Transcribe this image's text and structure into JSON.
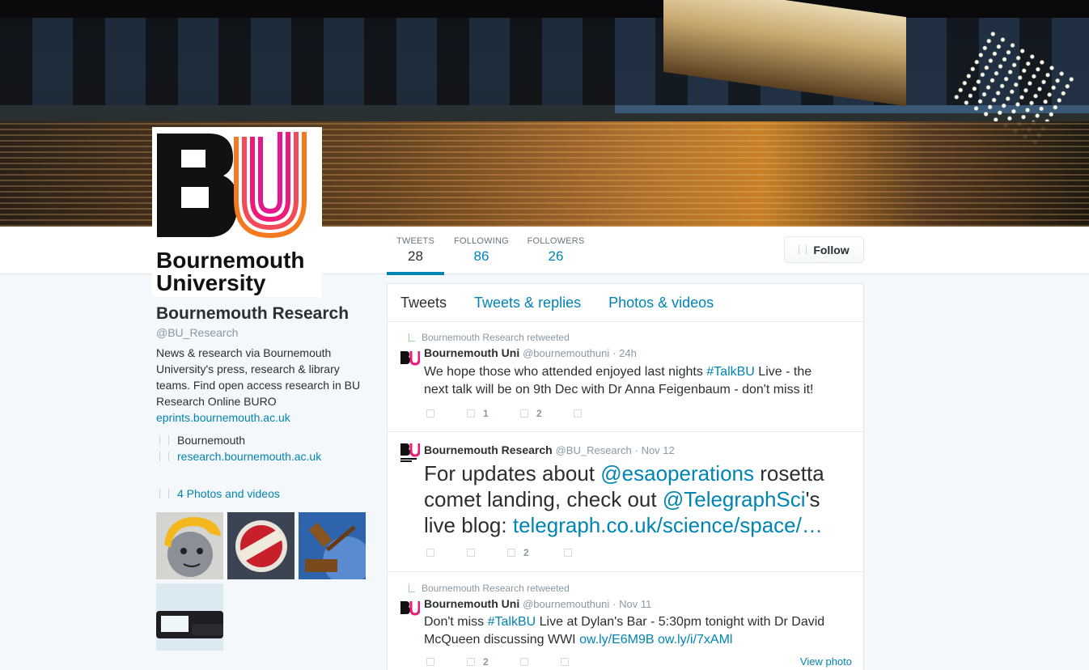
{
  "profile_nav": {
    "stats": [
      {
        "label": "TWEETS",
        "value": "28"
      },
      {
        "label": "FOLLOWING",
        "value": "86"
      },
      {
        "label": "FOLLOWERS",
        "value": "26"
      }
    ],
    "follow_label": "Follow"
  },
  "avatar": {
    "logo_letters": "BU",
    "logo_line1": "Bournemouth",
    "logo_line2": "University"
  },
  "profile": {
    "name": "Bournemouth Research",
    "handle": "@BU_Research",
    "bio": "News & research via Bournemouth University's press, research & library teams. Find open access research in BU Research Online BURO",
    "bio_url": "eprints.bournemouth.ac.uk",
    "location": "Bournemouth",
    "website": "research.bournemouth.ac.uk",
    "photos_label": "4 Photos and videos"
  },
  "tabs": [
    {
      "label": "Tweets",
      "active": true
    },
    {
      "label": "Tweets & replies",
      "active": false
    },
    {
      "label": "Photos & videos",
      "active": false
    }
  ],
  "tweets": [
    {
      "retweet_note": "Bournemouth Research retweeted",
      "name": "Bournemouth Uni",
      "handle": "@bournemouthuni",
      "time": "24h",
      "text_pre": "We hope those who attended enjoyed last nights ",
      "hashtag": "#TalkBU",
      "text_post": " Live - the next talk will be on 9th Dec with Dr Anna Feigenbaum - don't miss it!",
      "retweets": "1",
      "favorites": "2"
    },
    {
      "name": "Bournemouth Research",
      "handle": "@BU_Research",
      "time": "Nov 12",
      "text_1": "For updates about ",
      "mention_1": "@esaoperations",
      "text_2": " rosetta comet landing, check out ",
      "mention_2": "@TelegraphSci",
      "text_3": "'s live blog: ",
      "link": "telegraph.co.uk/science/space/…",
      "favorites": "2"
    },
    {
      "retweet_note": "Bournemouth Research retweeted",
      "name": "Bournemouth Uni",
      "handle": "@bournemouthuni",
      "time": "Nov 11",
      "text_1": "Don't miss ",
      "hashtag": "#TalkBU",
      "text_2": " Live at Dylan's Bar - 5:30pm tonight with Dr David McQueen discussing WWI ",
      "link_1": "ow.ly/E6M9B",
      "link_2": "ow.ly/i/7xAMl",
      "retweets": "2",
      "view_photo": "View photo"
    }
  ],
  "colors": {
    "link": "#0084b4",
    "text": "#292f33",
    "muted": "#8899a6",
    "logo_pink": "#ee1a7a",
    "logo_orange": "#f47a20"
  }
}
